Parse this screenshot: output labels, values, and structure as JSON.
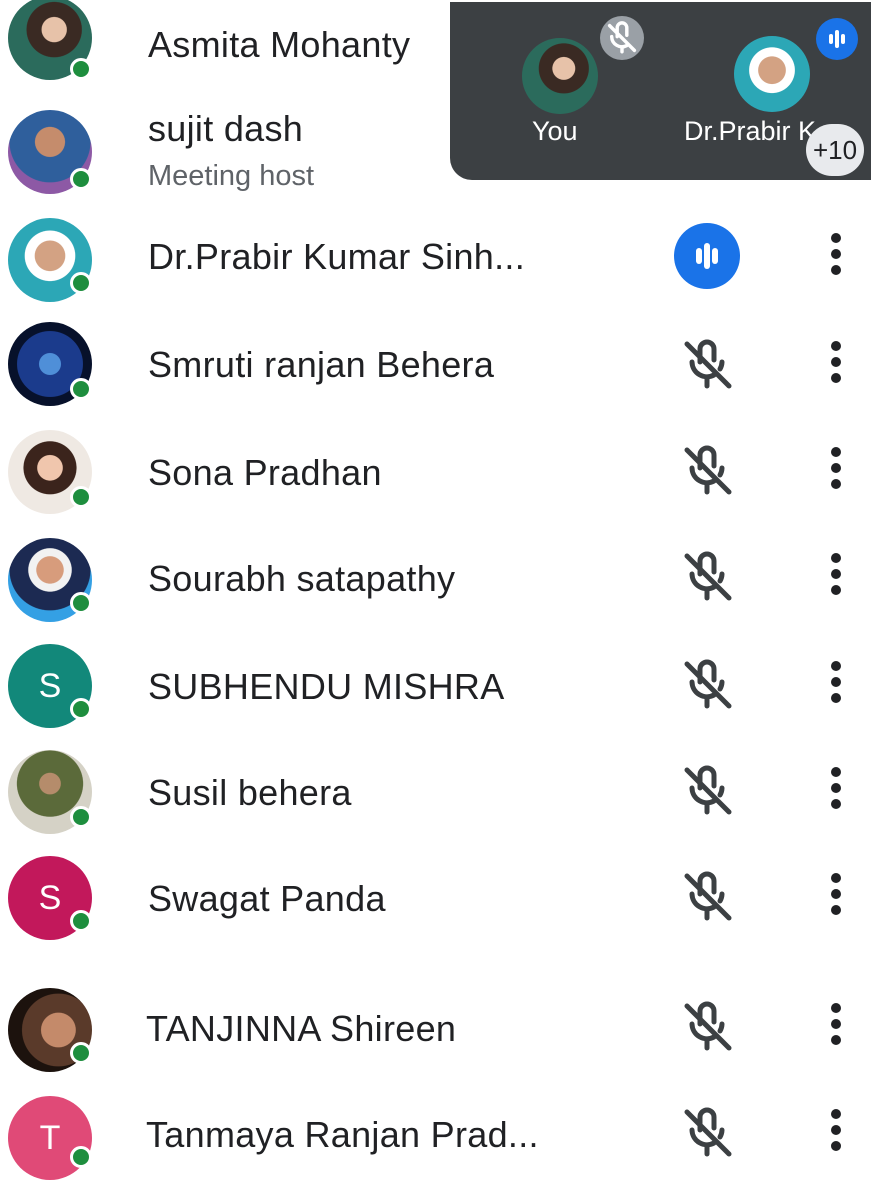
{
  "overlay": {
    "you_label": "You",
    "other_label": "Dr.Prabir K",
    "more_count": "+10"
  },
  "participants": [
    {
      "name": "Asmita Mohanty",
      "status": "self"
    },
    {
      "name": "sujit dash",
      "subtitle": "Meeting host"
    },
    {
      "name": "Dr.Prabir Kumar Sinh...",
      "status": "speaking"
    },
    {
      "name": "Smruti ranjan Behera",
      "status": "muted"
    },
    {
      "name": "Sona Pradhan",
      "status": "muted"
    },
    {
      "name": "Sourabh satapathy",
      "status": "muted"
    },
    {
      "name": "SUBHENDU MISHRA",
      "status": "muted",
      "initial": "S"
    },
    {
      "name": "Susil behera",
      "status": "muted"
    },
    {
      "name": "Swagat Panda",
      "status": "muted",
      "initial": "S"
    },
    {
      "name": "TANJINNA Shireen",
      "status": "muted"
    },
    {
      "name": "Tanmaya Ranjan Prad...",
      "status": "muted",
      "initial": "T"
    }
  ],
  "colors": {
    "speaking": "#1a73e8",
    "online": "#1e8e3e",
    "overlay_bg": "#3c4043",
    "avatar_subhendu": "#12887a",
    "avatar_swagat": "#c2185b",
    "avatar_tanmaya": "#e04a77"
  },
  "icons": [
    "microphone-off-icon",
    "audio-wave-icon",
    "more-vertical-icon"
  ]
}
